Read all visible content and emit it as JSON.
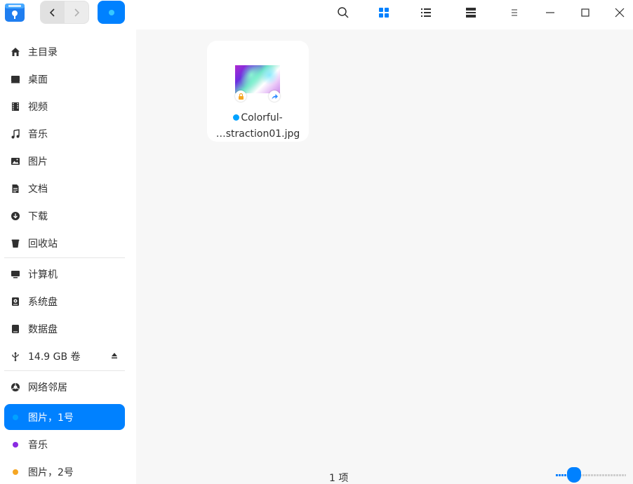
{
  "titlebar": {
    "back_label": "Back",
    "forward_label": "Forward"
  },
  "sidebar": {
    "items": [
      {
        "label": "主目录",
        "icon": "home-icon"
      },
      {
        "label": "桌面",
        "icon": "desktop-icon"
      },
      {
        "label": "视频",
        "icon": "video-icon"
      },
      {
        "label": "音乐",
        "icon": "music-icon"
      },
      {
        "label": "图片",
        "icon": "picture-icon"
      },
      {
        "label": "文档",
        "icon": "document-icon"
      },
      {
        "label": "下载",
        "icon": "download-icon"
      },
      {
        "label": "回收站",
        "icon": "trash-icon"
      }
    ],
    "devices": [
      {
        "label": "计算机",
        "icon": "computer-icon"
      },
      {
        "label": "系统盘",
        "icon": "system-disk-icon"
      },
      {
        "label": "数据盘",
        "icon": "data-disk-icon"
      },
      {
        "label": "14.9 GB 卷",
        "icon": "usb-icon"
      }
    ],
    "network": {
      "label": "网络邻居",
      "icon": "network-icon"
    },
    "tags": [
      {
        "label": "图片，1号",
        "color": "#00a2ff",
        "active": true
      },
      {
        "label": "音乐",
        "color": "#8a2be2",
        "active": false
      },
      {
        "label": "图片，2号",
        "color": "#f5a623",
        "active": false
      }
    ]
  },
  "main": {
    "file": {
      "name_line1": "Colorful-",
      "name_line2": "…straction01.jpg",
      "tag_color": "#00a2ff"
    },
    "status": "1 项",
    "zoom_level": 0.25
  },
  "colors": {
    "accent": "#0081ff",
    "main_bg": "#f7f7f7"
  }
}
